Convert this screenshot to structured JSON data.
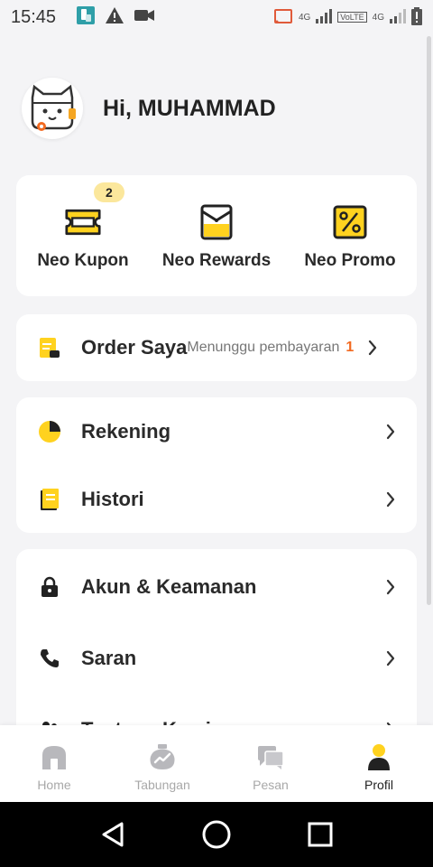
{
  "status_bar": {
    "time": "15:45",
    "network_4g": "4G",
    "volte": "VoLTE",
    "network_4g_2": "4G"
  },
  "header": {
    "greeting": "Hi, MUHAMMAD"
  },
  "quick_actions": [
    {
      "label": "Neo Kupon",
      "icon": "ticket-icon",
      "badge": "2"
    },
    {
      "label": "Neo Rewards",
      "icon": "envelope-icon"
    },
    {
      "label": "Neo Promo",
      "icon": "percent-icon"
    }
  ],
  "order": {
    "label": "Order Saya",
    "status": "Menunggu pembayaran",
    "count": "1"
  },
  "menu_group_1": [
    {
      "label": "Rekening",
      "icon": "pie-chart-icon"
    },
    {
      "label": "Histori",
      "icon": "book-icon"
    }
  ],
  "menu_group_2": [
    {
      "label": "Akun & Keamanan",
      "icon": "lock-icon"
    },
    {
      "label": "Saran",
      "icon": "phone-icon"
    },
    {
      "label": "Tentang Kami",
      "icon": "people-icon"
    }
  ],
  "bottom_nav": [
    {
      "label": "Home",
      "icon": "home-icon",
      "active": false
    },
    {
      "label": "Tabungan",
      "icon": "savings-icon",
      "active": false
    },
    {
      "label": "Pesan",
      "icon": "chat-icon",
      "active": false
    },
    {
      "label": "Profil",
      "icon": "person-icon",
      "active": true
    }
  ],
  "colors": {
    "accent_yellow": "#ffd21f",
    "order_count": "#f26a21",
    "active_nav": "#222222",
    "inactive_nav": "#a8a8a8"
  }
}
